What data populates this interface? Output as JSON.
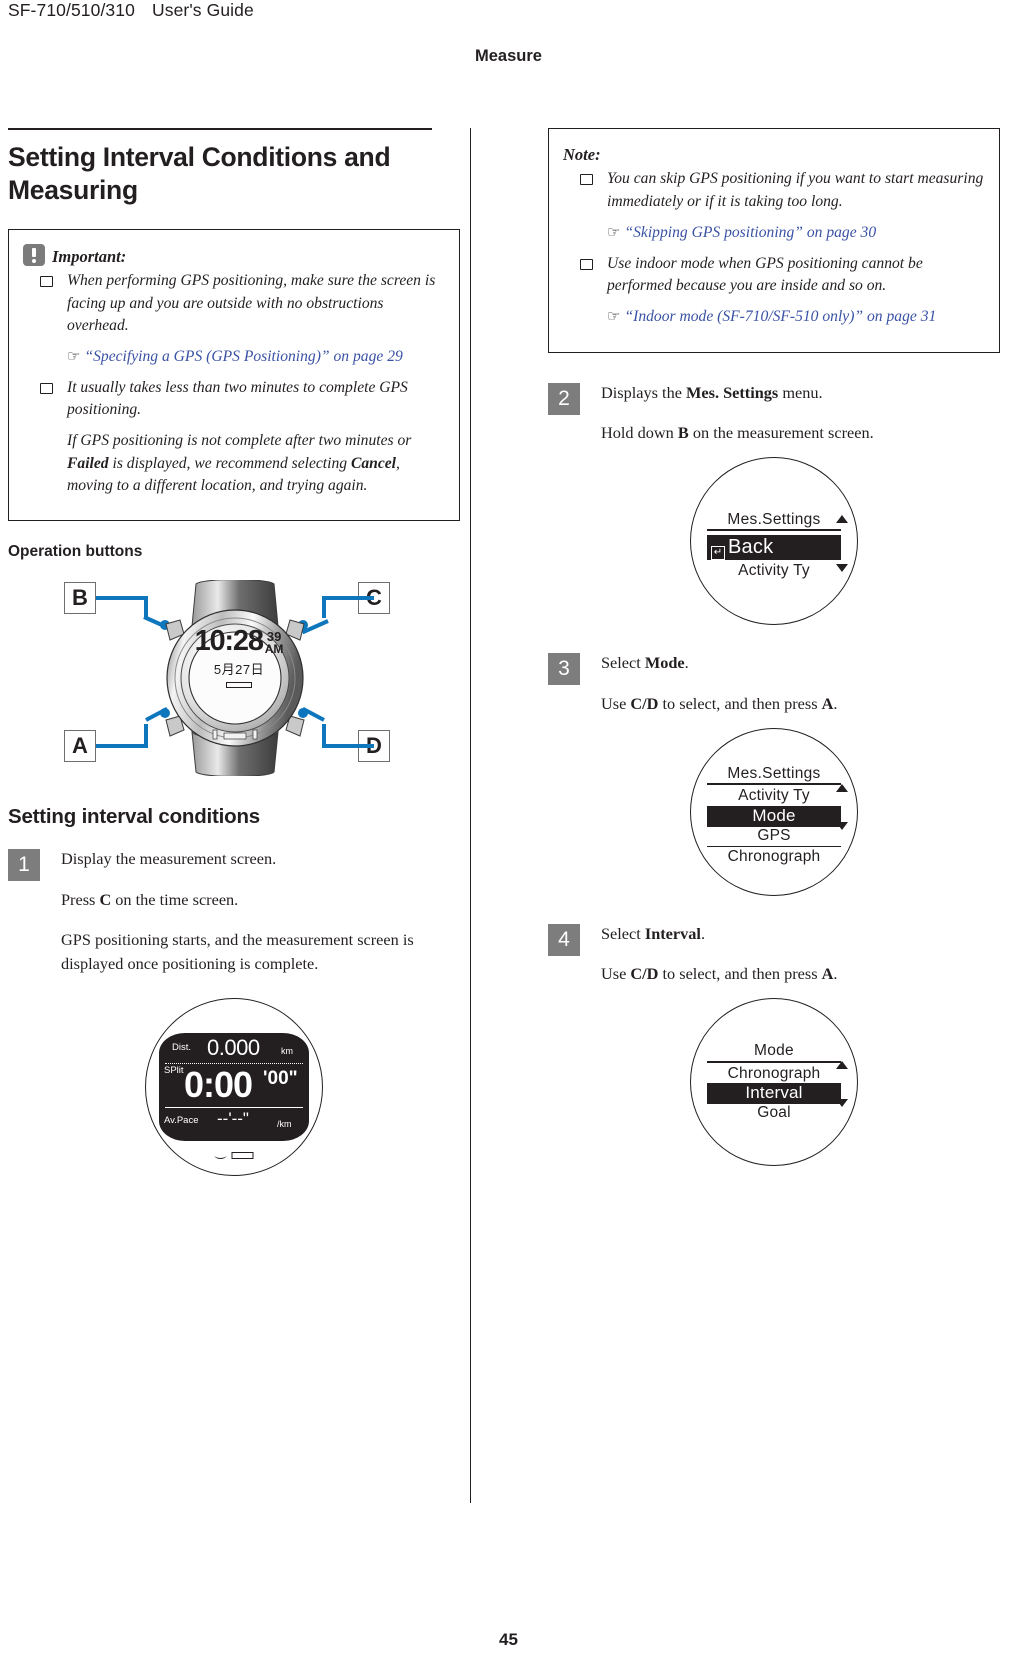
{
  "header": {
    "model": "SF-710/510/310",
    "guide": "User's Guide",
    "chapter": "Measure"
  },
  "footer": {
    "page_number": "45"
  },
  "left_column": {
    "title": "Setting Interval Conditions and Measuring",
    "important": {
      "label": "Important:",
      "icon": "important-icon",
      "bullets": [
        {
          "text": "When performing GPS positioning, make sure the screen is facing up and you are outside with no obstructions overhead.",
          "xref": "“Specifying a GPS (GPS Positioning)” on page 29"
        },
        {
          "text": "It usually takes less than two minutes to complete GPS positioning.",
          "extra": "If GPS positioning is not complete after two minutes or Failed is displayed, we recommend selecting Cancel, moving to a different location, and trying again.",
          "extra_bold_1": "Failed",
          "extra_bold_2": "Cancel"
        }
      ]
    },
    "operation_buttons": {
      "heading": "Operation buttons",
      "callouts": {
        "b": "B",
        "c": "C",
        "a": "A",
        "d": "D"
      },
      "watch_display": {
        "time": "10:28",
        "seconds": "39",
        "meridiem": "AM",
        "date": "5月27日"
      }
    },
    "section": {
      "heading": "Setting interval conditions",
      "step1": {
        "number": "1",
        "line1": "Display the measurement screen.",
        "line2_pre": "Press ",
        "line2_bold": "C",
        "line2_post": " on the time screen.",
        "line3": "GPS positioning starts, and the measurement screen is displayed once positioning is complete."
      }
    },
    "measurement_screen": {
      "dist_label": "Dist.",
      "dist_value": "0.000",
      "dist_unit": "km",
      "split_label": "SPlit",
      "split_value": "0:00",
      "split_suffix": "'00\"",
      "pace_label": "Av.Pace",
      "pace_value": "--'--\"",
      "pace_unit": "/km"
    }
  },
  "right_column": {
    "note": {
      "label": "Note:",
      "bullets": [
        {
          "text": "You can skip GPS positioning if you want to start measuring immediately or if it is taking too long.",
          "xref": "“Skipping GPS positioning” on page 30"
        },
        {
          "text": "Use indoor mode when GPS positioning cannot be performed because you are inside and so on.",
          "xref": "“Indoor mode (SF-710/SF-510 only)” on page 31"
        }
      ]
    },
    "steps": [
      {
        "number": "2",
        "line1_pre": "Displays the ",
        "line1_bold": "Mes. Settings",
        "line1_post": " menu.",
        "line2_pre": "Hold down ",
        "line2_bold": "B",
        "line2_post": " on the measurement screen.",
        "screen": {
          "title": "Mes.Settings",
          "rows": [
            {
              "label": "Back",
              "selected": true,
              "icon": "back-icon"
            },
            {
              "label": "Activity Ty",
              "selected": false
            }
          ],
          "scroll_up": true,
          "scroll_down": true
        }
      },
      {
        "number": "3",
        "line1_pre": "Select ",
        "line1_bold": "Mode",
        "line1_post": ".",
        "line2_pre": "Use ",
        "line2_bold": "C/D",
        "line2_mid": " to select, and then press ",
        "line2_bold2": "A",
        "line2_post": ".",
        "screen": {
          "title": "Mes.Settings",
          "rows": [
            {
              "label": "Activity Ty",
              "selected": false
            },
            {
              "label": "Mode",
              "selected": true
            },
            {
              "label": "GPS",
              "selected": false
            },
            {
              "label": "Chronograph",
              "selected": false
            }
          ],
          "scroll_up": true,
          "scroll_down": true
        }
      },
      {
        "number": "4",
        "line1_pre": "Select ",
        "line1_bold": "Interval",
        "line1_post": ".",
        "line2_pre": "Use ",
        "line2_bold": "C/D",
        "line2_mid": " to select, and then press ",
        "line2_bold2": "A",
        "line2_post": ".",
        "screen": {
          "title": "Mode",
          "rows": [
            {
              "label": "Chronograph",
              "selected": false
            },
            {
              "label": "Interval",
              "selected": true
            },
            {
              "label": "Goal",
              "selected": false
            }
          ],
          "scroll_up": true,
          "scroll_down": true
        }
      }
    ]
  },
  "colors": {
    "link": "#3a52a4",
    "callout_line": "#0d76bc",
    "step_badge": "#7d7d7d",
    "text": "#231f20"
  }
}
